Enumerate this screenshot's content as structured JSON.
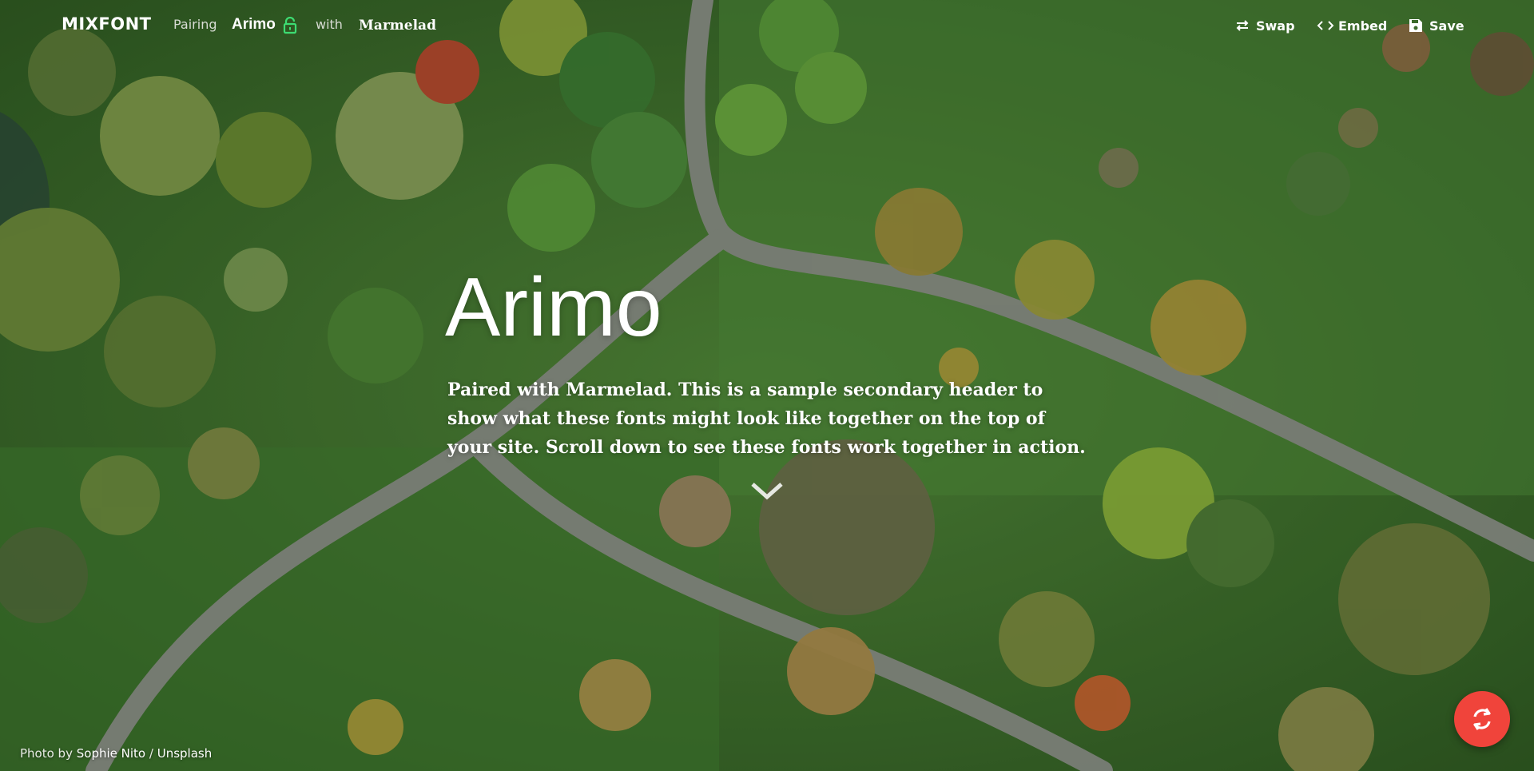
{
  "topbar": {
    "logo": "MIXFONT",
    "pairing_label": "Pairing",
    "primary_font": "Arimo",
    "with_label": "with",
    "secondary_font": "Marmelad",
    "lock_icon": "lock-open-icon",
    "actions": [
      {
        "label": "Swap",
        "icon": "swap-icon"
      },
      {
        "label": "Embed",
        "icon": "code-icon"
      },
      {
        "label": "Save",
        "icon": "save-icon"
      }
    ]
  },
  "hero": {
    "title": "Arimo",
    "subtitle": "Paired with Marmelad. This is a sample secondary header to show what these fonts might look like together on the top of your site. Scroll down to see these fonts work together in action.",
    "scroll_icon": "chevron-down-icon"
  },
  "credit": {
    "prefix": "Photo by",
    "author": "Sophie Nito",
    "separator": "/",
    "source": "Unsplash"
  },
  "refresh_button": {
    "icon": "refresh-icon",
    "color": "#f0443b"
  },
  "colors": {
    "accent_lock": "#3ddc72",
    "text": "#ffffff"
  }
}
